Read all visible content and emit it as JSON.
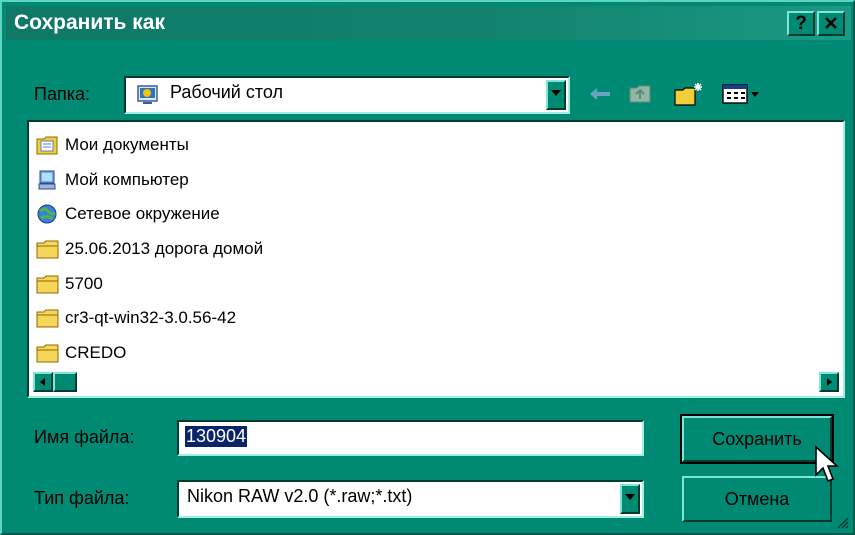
{
  "window": {
    "title": "Сохранить как",
    "help_button": "?",
    "close_button": "X"
  },
  "folder": {
    "label": "Папка:",
    "value": "Рабочий стол"
  },
  "toolbar": {
    "icons": [
      "back-arrow-icon",
      "up-folder-icon",
      "new-folder-icon",
      "view-menu-icon"
    ]
  },
  "files": [
    {
      "name": "Мои документы",
      "icon": "my-documents-icon"
    },
    {
      "name": "Мой компьютер",
      "icon": "my-computer-icon"
    },
    {
      "name": "Сетевое окружение",
      "icon": "network-icon"
    },
    {
      "name": "25.06.2013 дорога домой",
      "icon": "folder-icon"
    },
    {
      "name": "5700",
      "icon": "folder-icon"
    },
    {
      "name": "cr3-qt-win32-3.0.56-42",
      "icon": "folder-icon"
    },
    {
      "name": "CREDO",
      "icon": "folder-icon"
    }
  ],
  "filename": {
    "label": "Имя файла:",
    "value": "130904"
  },
  "filetype": {
    "label": "Тип файла:",
    "value": "Nikon RAW v2.0 (*.raw;*.txt)"
  },
  "buttons": {
    "save": "Сохранить",
    "cancel": "Отмена"
  },
  "colors": {
    "window_bg": "#008a74",
    "selection": "#0a246a"
  }
}
